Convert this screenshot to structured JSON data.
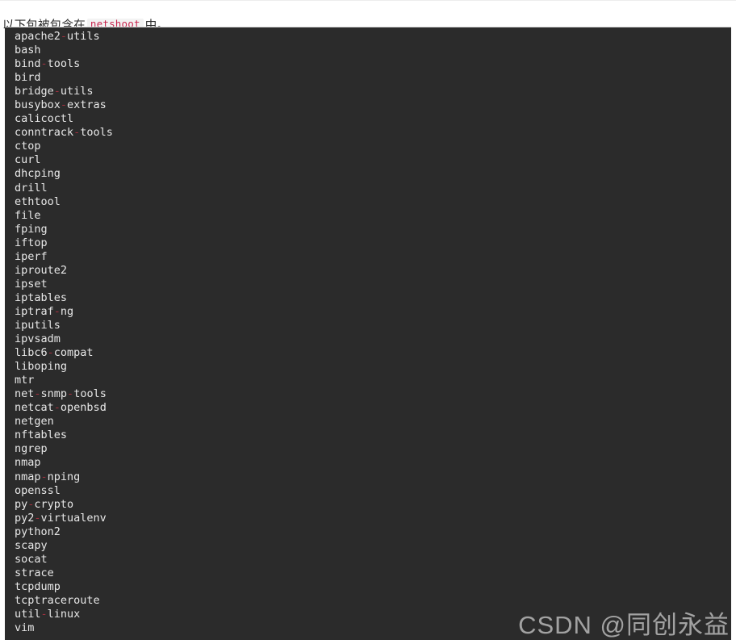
{
  "header": {
    "text_before": "以下包被包含在",
    "inline_code": "netshoot",
    "text_after": "中。"
  },
  "code_block": {
    "language": "text",
    "background_color": "#2b2b2b",
    "text_color": "#e8e8e8",
    "punctuation_color": "#a0303f",
    "packages": [
      "apache2-utils",
      "bash",
      "bind-tools",
      "bird",
      "bridge-utils",
      "busybox-extras",
      "calicoctl",
      "conntrack-tools",
      "ctop",
      "curl",
      "dhcping",
      "drill",
      "ethtool",
      "file",
      "fping",
      "iftop",
      "iperf",
      "iproute2",
      "ipset",
      "iptables",
      "iptraf-ng",
      "iputils",
      "ipvsadm",
      "libc6-compat",
      "liboping",
      "mtr",
      "net-snmp-tools",
      "netcat-openbsd",
      "netgen",
      "nftables",
      "ngrep",
      "nmap",
      "nmap-nping",
      "openssl",
      "py-crypto",
      "py2-virtualenv",
      "python2",
      "scapy",
      "socat",
      "strace",
      "tcpdump",
      "tcptraceroute",
      "util-linux",
      "vim"
    ]
  },
  "watermark": {
    "text": "CSDN @同创永益"
  }
}
